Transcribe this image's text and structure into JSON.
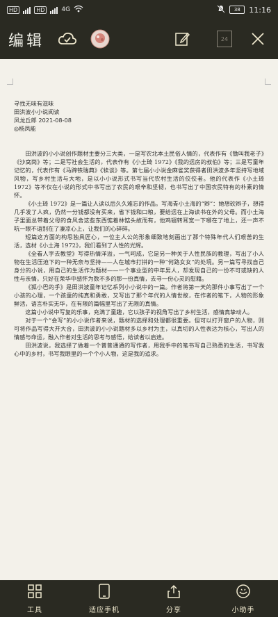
{
  "status_bar": {
    "sim1": "HD",
    "sim2": "HD",
    "network": "4G",
    "speed": "",
    "battery": "38",
    "time": "11:16"
  },
  "toolbar": {
    "title": "编辑",
    "page_indicator": "24"
  },
  "document": {
    "meta_lines": [
      "寻找无味有滋味",
      "田洪波小小说阅读",
      "凤龙丘郎 2021-08-08",
      "◎杨凤能"
    ],
    "paragraphs": [
      "田洪波的小小说创作题材主要分三大类，一是写农北本土民俗人情的，代表作有《锄叫我老子》《沙窝岗》等；二是写社会生活的，代表作有《小土琦 1972》《我的远房的叔伯》等；三是写童年记忆的，代表作有《马蹄铁瑞典》《犊谈》等。第七届小小说金麻雀奖获得者田洪波多年坚持写地域风物，写乡村生活与大地，是以小小说形式书写当代农村生活的佼佼者。他的代表作《小土琦 1972》等不仅在小说的形式中书写出了农民的艰辛和坚韧，也书写出了中国农民特有的朴素的情怀。",
      "《小土琦 1972》是一篇让人读以后久久难忘的作品。写海青小土海的“辫”：她想砍辫子，想得几乎发了人疯，仍然一分钱都没有买来，省下钱和口粮，要给远在上海读书在外的父母。而小土海子里面总带着父母的食风舍这些东西惦着林惦头故而有，他鸡辍转耳宽一下哪在了地上，还一声不吭一眼不语别在了凄凉心上，让我们的心碎碎。",
      "短篇这方面的构思独具匠心，一位主人公的形象细致地刻画出了那个特殊年代人们艰苦的生活，选材《小土海 1972》，我们看到了人性的光辉。",
      "《全看人字去教堂》写得热情洋溢，一气呵成，它是另一种关于人性民族的教理，写出了小人物在生活压迫下的一种无奈与坚持——人在城市打拼的一种“何路女女”的处境。另一篇写寻找自己身分的小说，用自己的生活作为题材——一个事业型的中年男人，却发现自己的一份不可或缺的人性与亲情，只好在荣华中感怀为数不多的那一份真情，去寻一份心灵的慰藉。",
      "《狐小巴的手》是田洪波童年记忆系列小小说中的一篇。作者将第一天的那件小事写出了一个小孩的心理，一个孩童的纯真和勇敢，又写出了那个年代的人情世故，在作者的笔下，人物的形象鲜活，语言朴实无华，在有限的篇幅里写出了无限的真情。",
      "这篇小小说中写复的乐事，充满了童趣，它以孩子的视角写出了乡村生活，感情真挚动人。",
      "对于一个“会写”的小小说作者来说，题材的选择和处理都很重要。但可以打开窗户的人物，则可将作品写得大开大合，田洪波的小小说题材多以乡村为主，以真切的人性表达为核心，写出人的情感与命运，融入作者对生活的思考与感悟，给读者以启迪。",
      "田洪波说，我选择了做着一个普普通通的写作者，用我手中的笔书写自己熟悉的生活，书写我心中的乡村，书写我眼里的一个个小人物，这是我的追求。"
    ]
  },
  "bottom_nav": {
    "items": [
      {
        "label": "工具",
        "icon": "tools-icon"
      },
      {
        "label": "适应手机",
        "icon": "phone-fit-icon"
      },
      {
        "label": "分享",
        "icon": "share-icon"
      },
      {
        "label": "小助手",
        "icon": "assistant-icon"
      }
    ]
  },
  "colors": {
    "bar_bg": "#2a2a22",
    "page_bg": "#f3f1ea",
    "accent_label": "#f0e9cf"
  }
}
